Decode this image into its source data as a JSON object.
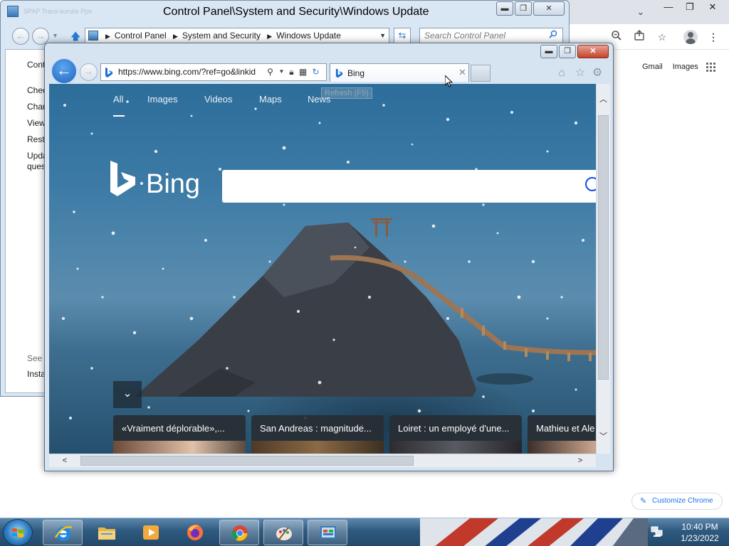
{
  "chrome": {
    "gmail_link": "Gmail",
    "images_link": "Images",
    "customize_label": "Customize Chrome"
  },
  "control_panel": {
    "faded_tabs": "SPAP   Trans-kurske Ppe",
    "title": "Control Panel\\System and Security\\Windows Update",
    "breadcrumb": [
      "Control Panel",
      "System and Security",
      "Windows Update"
    ],
    "search_placeholder": "Search Control Panel",
    "sidebar_items": [
      "Cont",
      "Chec",
      "Chan",
      "View",
      "Resto",
      "Upda",
      "ques",
      "See a",
      "Insta"
    ]
  },
  "ie": {
    "url": "https://www.bing.com/?ref=go&linkid",
    "tab_title": "Bing",
    "tooltip": "Refresh (F5)",
    "bing": {
      "wordmark": "Bing",
      "nav": [
        "All",
        "Images",
        "Videos",
        "Maps",
        "News"
      ],
      "news": [
        "«Vraiment déplorable»,...",
        "San Andreas : magnitude...",
        "Loiret : un employé d'une...",
        "Mathieu et Ale"
      ]
    }
  },
  "taskbar": {
    "apps": [
      "internet-explorer",
      "file-explorer",
      "media-player",
      "firefox",
      "chrome",
      "paint",
      "control-panel"
    ],
    "clock_time": "10:40 PM",
    "clock_date": "1/23/2022"
  },
  "colors": {
    "bing_blue": "#174ae4",
    "ie_back": "#1d63c1",
    "chrome_accent": "#1a73e8",
    "taskbar": "#2f5a80"
  }
}
